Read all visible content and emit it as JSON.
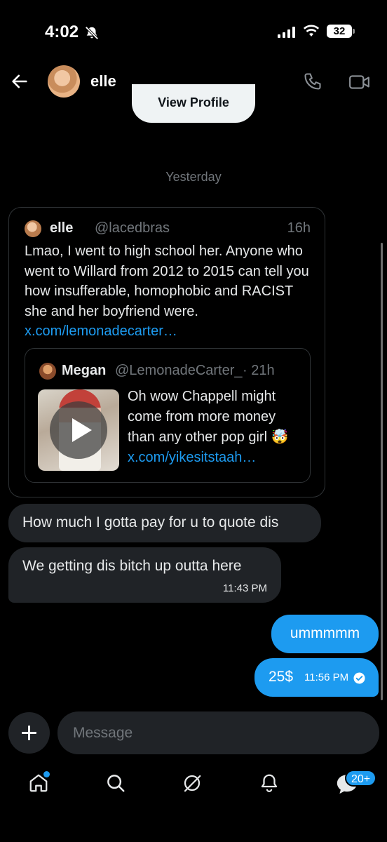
{
  "status_bar": {
    "time": "4:02",
    "battery": "32"
  },
  "header": {
    "contact_name": "elle"
  },
  "view_profile_label": "View Profile",
  "date_separator": "Yesterday",
  "shared_tweet": {
    "author": "elle",
    "handle": "@lacedbras",
    "time": "16h",
    "text": "Lmao, I went to high school her. Anyone who went to Willard from 2012 to 2015 can tell you how insufferable, homophobic and RACIST she and her boyfriend were. ",
    "link": "x.com/lemonadecarter…",
    "quote": {
      "author": "Megan",
      "handle": "@LemonadeCarter_",
      "time": "· 21h",
      "text": "Oh wow Chappell might come from more money than any other pop girl ",
      "emoji": "🤯",
      "link": "x.com/yikesitstaah…"
    }
  },
  "messages": {
    "in_1": "How much I gotta pay for u to quote dis",
    "in_2": "We getting dis bitch up outta here",
    "in_2_time": "11:43 PM",
    "out_1": "ummmmm",
    "out_2": "25$",
    "out_2_time": "11:56 PM"
  },
  "composer": {
    "placeholder": "Message"
  },
  "nav": {
    "messages_badge": "20+"
  },
  "colors": {
    "accent": "#1d9bf0",
    "bubble_in": "#202327",
    "muted": "#71767b"
  }
}
